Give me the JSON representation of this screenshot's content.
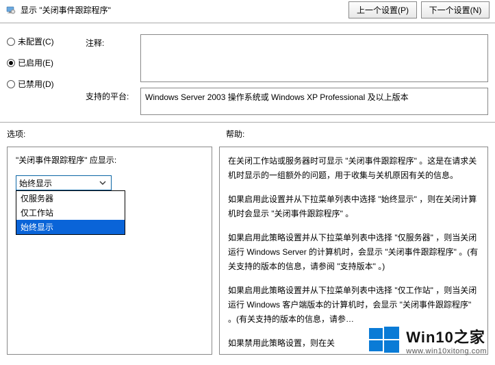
{
  "header": {
    "icon": "gear-monitor-icon",
    "title": "显示 \"关闭事件跟踪程序\"",
    "prev_button": "上一个设置(P)",
    "next_button": "下一个设置(N)"
  },
  "config": {
    "not_configured": "未配置(C)",
    "enabled": "已启用(E)",
    "disabled": "已禁用(D)",
    "selected": "enabled",
    "comment_label": "注释:",
    "comment_value": "",
    "platform_label": "支持的平台:",
    "platform_value": "Windows Server 2003 操作系统或 Windows XP Professional 及以上版本"
  },
  "labels": {
    "options": "选项:",
    "help": "帮助:"
  },
  "options": {
    "prompt": "\"关闭事件跟踪程序\" 应显示:",
    "combo_value": "始终显示",
    "dropdown": {
      "item1": "仅服务器",
      "item2": "仅工作站",
      "item3": "始终显示"
    }
  },
  "help": {
    "p1": "在关闭工作站或服务器时可显示 \"关闭事件跟踪程序\" 。这是在请求关机时显示的一组额外的问题，用于收集与关机原因有关的信息。",
    "p2": "如果启用此设置并从下拉菜单列表中选择 \"始终显示\" ，则在关闭计算机时会显示 \"关闭事件跟踪程序\" 。",
    "p3": "如果启用此策略设置并从下拉菜单列表中选择 \"仅服务器\" ，则当关闭运行 Windows Server 的计算机时，会显示 \"关闭事件跟踪程序\" 。(有关支持的版本的信息，请参阅 \"支持版本\" 。)",
    "p4": "如果启用此策略设置并从下拉菜单列表中选择 \"仅工作站\" ，则当关闭运行 Windows 客户端版本的计算机时，会显示 \"关闭事件跟踪程序\" 。(有关支持的版本的信息，请参…",
    "p5": "如果禁用此策略设置，则在关"
  },
  "watermark": {
    "title": "Win10之家",
    "url": "www.win10xitong.com"
  }
}
